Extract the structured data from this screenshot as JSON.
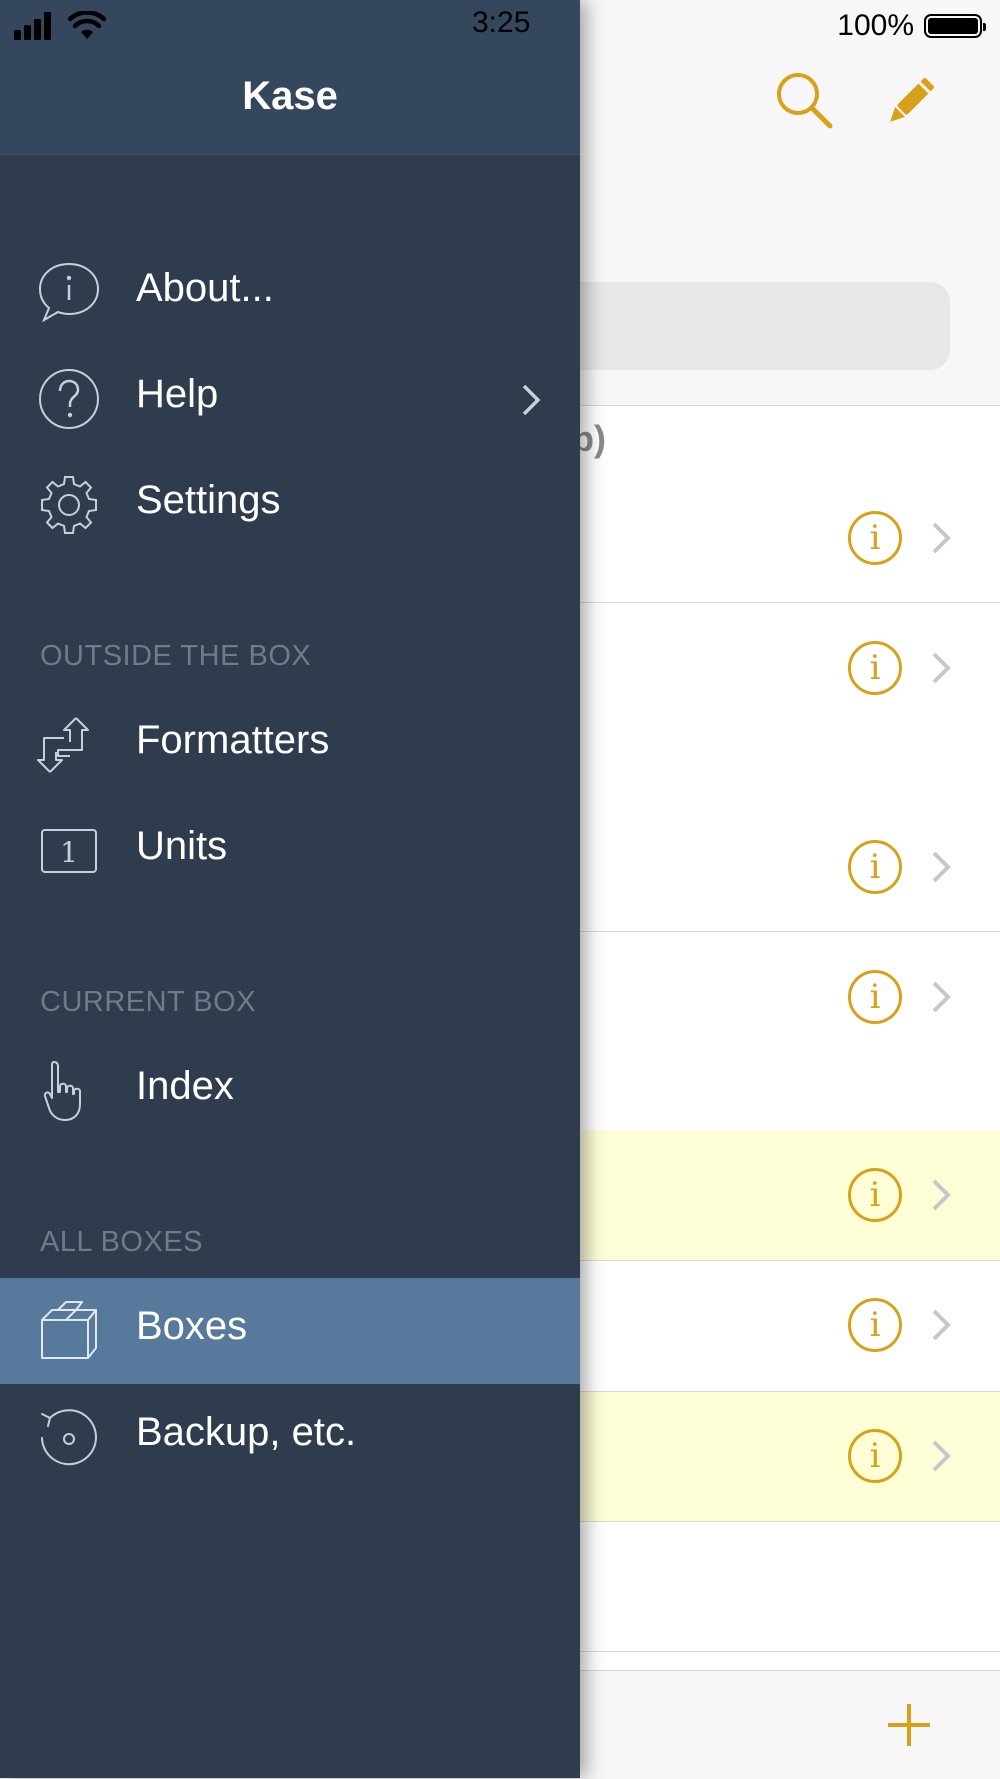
{
  "status_bar": {
    "time": "3:25",
    "battery_percent": "100%"
  },
  "background": {
    "section_fragment": "p)",
    "info_glyph": "i",
    "add_glyph": "+"
  },
  "menu": {
    "title": "Kase",
    "items_top": [
      {
        "label": "About...",
        "icon": "info-bubble-icon"
      },
      {
        "label": "Help",
        "icon": "question-icon",
        "has_chevron": true
      },
      {
        "label": "Settings",
        "icon": "gear-icon"
      }
    ],
    "section_outside": "OUTSIDE THE BOX",
    "items_outside": [
      {
        "label": "Formatters",
        "icon": "formatters-arrows-icon"
      },
      {
        "label": "Units",
        "icon": "units-icon",
        "glyph": "1"
      }
    ],
    "section_current": "CURRENT BOX",
    "items_current": [
      {
        "label": "Index",
        "icon": "pointing-hand-icon"
      }
    ],
    "section_all": "ALL BOXES",
    "items_all": [
      {
        "label": "Boxes",
        "icon": "box-icon",
        "selected": true
      },
      {
        "label": "Backup, etc.",
        "icon": "backup-restore-icon"
      }
    ]
  },
  "colors": {
    "menu_bg": "#2e3c4e",
    "menu_header_bg": "#34475c",
    "selected_bg": "#56799c",
    "accent": "#d9a11a",
    "highlight_row": "#fdfdd6"
  }
}
